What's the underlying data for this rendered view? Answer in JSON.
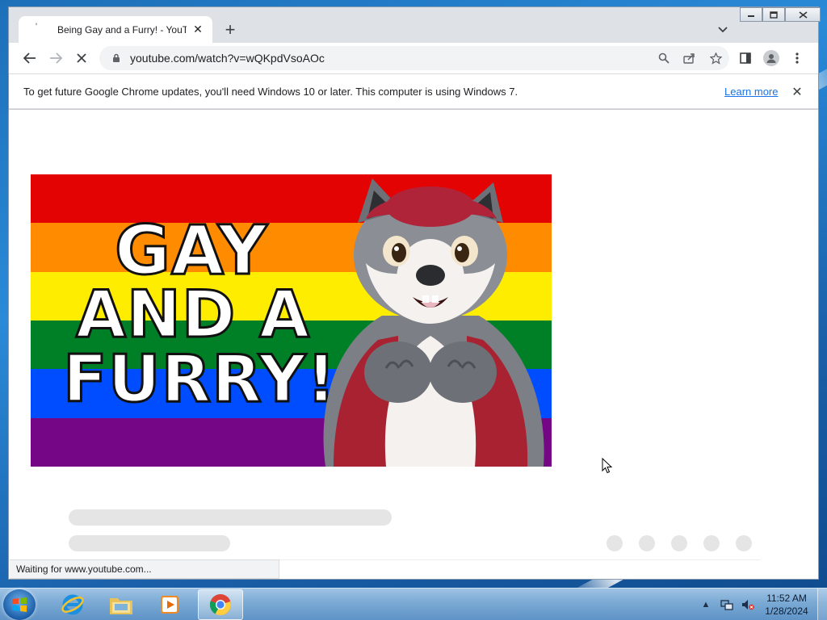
{
  "browser": {
    "tab": {
      "title": "Being Gay and a Furry! - YouTube",
      "favicon": "loading-spinner-icon",
      "close": "✕"
    },
    "new_tab": "+",
    "url": "youtube.com/watch?v=wQKpdVsoAOc",
    "infobar": {
      "message": "To get future Google Chrome updates, you'll need Windows 10 or later. This computer is using Windows 7.",
      "link": "Learn more",
      "close": "✕"
    },
    "status": "Waiting for www.youtube.com..."
  },
  "video": {
    "thumbnail_lines": [
      "GAY",
      "AND A",
      "FURRY!"
    ],
    "flag_colors": [
      "#e40303",
      "#ff8c00",
      "#ffed00",
      "#008026",
      "#004dff",
      "#750787"
    ]
  },
  "taskbar": {
    "apps": [
      "start-orb",
      "internet-explorer",
      "windows-explorer",
      "media-player",
      "google-chrome"
    ],
    "clock": {
      "time": "11:52 AM",
      "date": "1/28/2024"
    }
  }
}
